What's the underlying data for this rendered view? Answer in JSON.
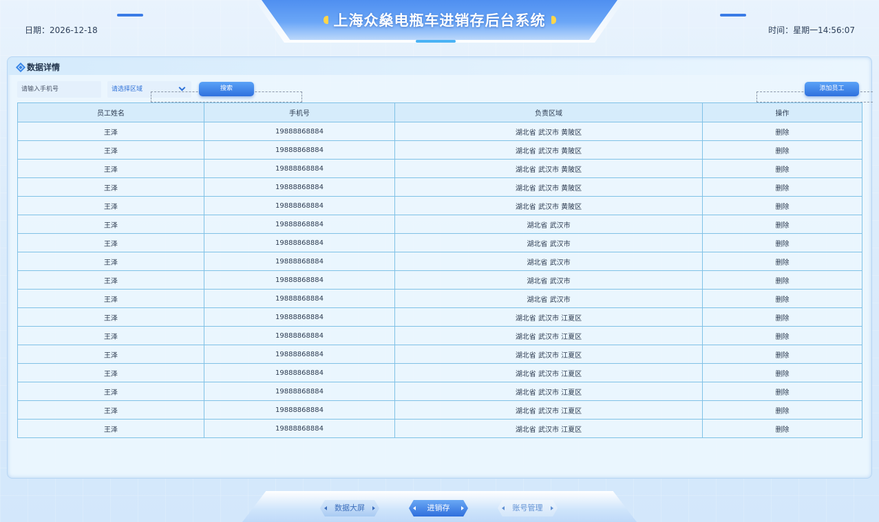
{
  "header": {
    "title": "上海众燊电瓶车进销存后台系统",
    "date_label": "日期：2026-12-18",
    "time_label": "时间：星期一14:56:07"
  },
  "panel": {
    "title": "数据详情",
    "phone_placeholder": "请输入手机号",
    "region_placeholder": "请选择区域",
    "search_label": "搜索",
    "add_label": "添加员工"
  },
  "table": {
    "headers": [
      "员工姓名",
      "手机号",
      "负责区域",
      "操作"
    ],
    "rows": [
      {
        "name": "王泽",
        "phone": "19888868884",
        "region": "湖北省 武汉市 黄陂区",
        "action": "删除"
      },
      {
        "name": "王泽",
        "phone": "19888868884",
        "region": "湖北省 武汉市 黄陂区",
        "action": "删除"
      },
      {
        "name": "王泽",
        "phone": "19888868884",
        "region": "湖北省 武汉市 黄陂区",
        "action": "删除"
      },
      {
        "name": "王泽",
        "phone": "19888868884",
        "region": "湖北省 武汉市 黄陂区",
        "action": "删除"
      },
      {
        "name": "王泽",
        "phone": "19888868884",
        "region": "湖北省 武汉市 黄陂区",
        "action": "删除"
      },
      {
        "name": "王泽",
        "phone": "19888868884",
        "region": "湖北省 武汉市",
        "action": "删除"
      },
      {
        "name": "王泽",
        "phone": "19888868884",
        "region": "湖北省 武汉市",
        "action": "删除"
      },
      {
        "name": "王泽",
        "phone": "19888868884",
        "region": "湖北省 武汉市",
        "action": "删除"
      },
      {
        "name": "王泽",
        "phone": "19888868884",
        "region": "湖北省 武汉市",
        "action": "删除"
      },
      {
        "name": "王泽",
        "phone": "19888868884",
        "region": "湖北省 武汉市",
        "action": "删除"
      },
      {
        "name": "王泽",
        "phone": "19888868884",
        "region": "湖北省 武汉市 江夏区",
        "action": "删除"
      },
      {
        "name": "王泽",
        "phone": "19888868884",
        "region": "湖北省 武汉市 江夏区",
        "action": "删除"
      },
      {
        "name": "王泽",
        "phone": "19888868884",
        "region": "湖北省 武汉市 江夏区",
        "action": "删除"
      },
      {
        "name": "王泽",
        "phone": "19888868884",
        "region": "湖北省 武汉市 江夏区",
        "action": "删除"
      },
      {
        "name": "王泽",
        "phone": "19888868884",
        "region": "湖北省 武汉市 江夏区",
        "action": "删除"
      },
      {
        "name": "王泽",
        "phone": "19888868884",
        "region": "湖北省 武汉市 江夏区",
        "action": "删除"
      },
      {
        "name": "王泽",
        "phone": "19888868884",
        "region": "湖北省 武汉市 江夏区",
        "action": "删除"
      }
    ]
  },
  "nav": {
    "items": [
      {
        "label": "数据大屏",
        "state": "off"
      },
      {
        "label": "进销存",
        "state": "on"
      },
      {
        "label": "账号管理",
        "state": "dim"
      }
    ]
  },
  "colors": {
    "accent": "#2f70de",
    "title_dot": "#ffd54a",
    "table_border": "#7fc1e6"
  }
}
